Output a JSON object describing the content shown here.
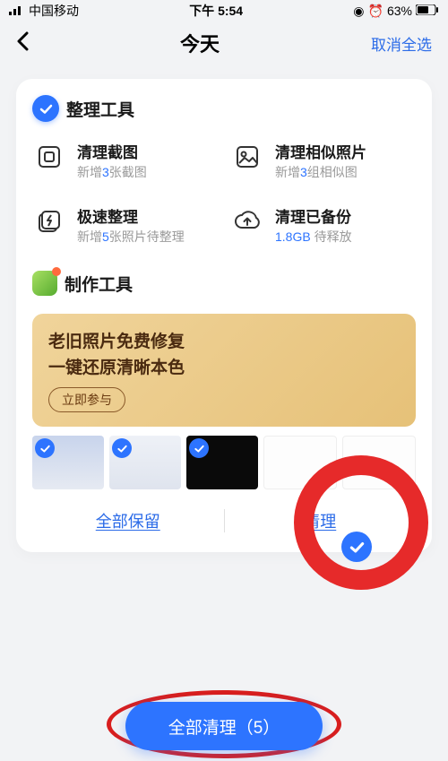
{
  "status": {
    "carrier": "中国移动",
    "time": "下午 5:54",
    "battery": "63%"
  },
  "nav": {
    "title": "今天",
    "action": "取消全选"
  },
  "organize": {
    "title": "整理工具",
    "tools": [
      {
        "title": "清理截图",
        "sub_prefix": "新增",
        "sub_value": "3",
        "sub_suffix": "张截图"
      },
      {
        "title": "清理相似照片",
        "sub_prefix": "新增",
        "sub_value": "3",
        "sub_suffix": "组相似图"
      },
      {
        "title": "极速整理",
        "sub_prefix": "新增",
        "sub_value": "5",
        "sub_suffix": "张照片待整理"
      },
      {
        "title": "清理已备份",
        "sub_prefix": "",
        "sub_value": "1.8GB",
        "sub_suffix": " 待释放"
      }
    ]
  },
  "creation": {
    "title": "制作工具",
    "promo_line1": "老旧照片免费修复",
    "promo_line2": "一键还原清晰本色",
    "promo_btn": "立即参与"
  },
  "actions": {
    "keep_all": "全部保留",
    "clean": "清理"
  },
  "primary_button": "全部清理（5）"
}
